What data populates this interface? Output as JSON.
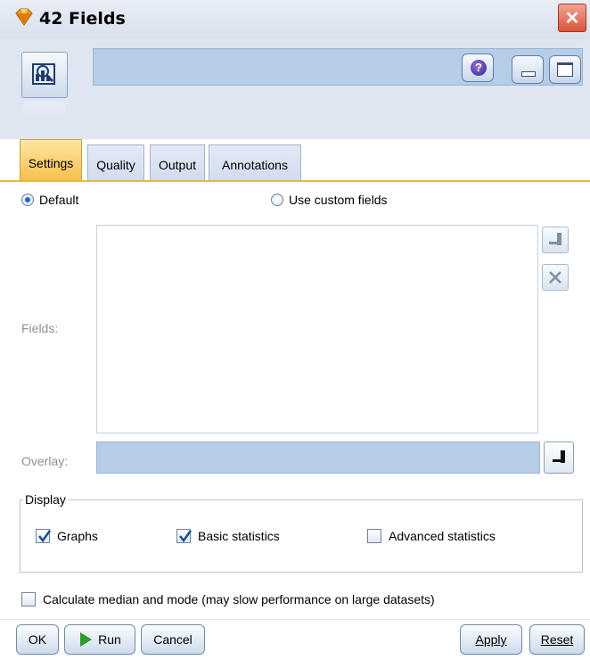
{
  "window": {
    "title": "42 Fields",
    "close_glyph": "✕"
  },
  "header": {
    "help_glyph": "?"
  },
  "tabs": [
    {
      "label": "Settings",
      "active": true
    },
    {
      "label": "Quality",
      "active": false
    },
    {
      "label": "Output",
      "active": false
    },
    {
      "label": "Annotations",
      "active": false
    }
  ],
  "settings": {
    "radio_default": {
      "label": "Default",
      "checked": true
    },
    "radio_custom": {
      "label": "Use custom fields",
      "checked": false
    },
    "fields_label": "Fields:",
    "fields_list": [],
    "overlay_label": "Overlay:",
    "overlay_value": "",
    "display": {
      "legend": "Display",
      "graphs": {
        "label": "Graphs",
        "checked": true
      },
      "basic_statistics": {
        "label": "Basic statistics",
        "checked": true
      },
      "advanced_statistics": {
        "label": "Advanced statistics",
        "checked": false
      }
    },
    "median_mode": {
      "label": "Calculate median and mode (may slow performance on large datasets)",
      "checked": false
    }
  },
  "buttons": {
    "ok": "OK",
    "run": "Run",
    "cancel": "Cancel",
    "apply": "Apply",
    "reset": "Reset"
  },
  "icons": {
    "app": "gem-icon",
    "node": "data-audit-node-icon",
    "help": "help-icon",
    "minimize": "minimize-icon",
    "maximize": "maximize-icon",
    "close": "close-icon",
    "field_picker": "field-picker-icon",
    "remove": "remove-icon",
    "run": "play-icon"
  },
  "colors": {
    "active_tab": "#f7c04c",
    "header_bg": "#dde6f1",
    "field_bg": "#b6cde7",
    "check_mark": "#1d4f9c",
    "run_arrow": "#2e9b2e"
  }
}
